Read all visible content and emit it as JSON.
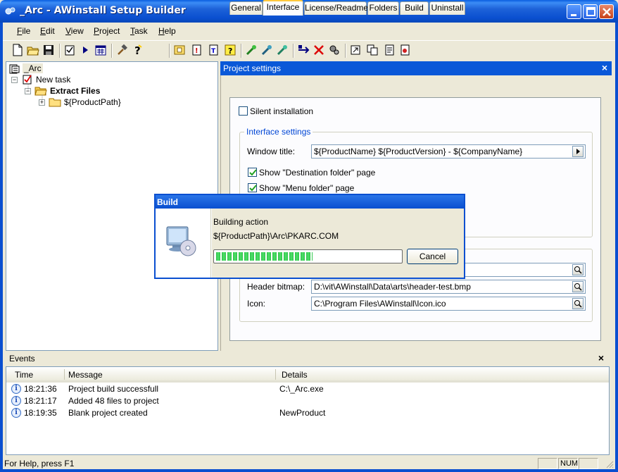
{
  "window": {
    "title": "_Arc - AWinstall Setup Builder"
  },
  "menu": [
    "File",
    "Edit",
    "View",
    "Project",
    "Task",
    "Help"
  ],
  "menu_accel": [
    "F",
    "E",
    "V",
    "P",
    "T",
    "H"
  ],
  "tree": {
    "root": "_Arc",
    "task": "New task",
    "extract": "Extract Files",
    "path": "${ProductPath}"
  },
  "project_settings": {
    "title": "Project settings",
    "tabs": [
      "General",
      "Interface",
      "License/Readme",
      "Folders",
      "Build",
      "Uninstall"
    ],
    "active_tab": "Interface",
    "silent_installation": {
      "label": "Silent installation",
      "checked": false
    },
    "interface_group": "Interface settings",
    "window_title_label": "Window title:",
    "window_title_value": "${ProductName} ${ProductVersion} - ${CompanyName}",
    "show_dest": {
      "label": "Show \"Destination folder\" page",
      "checked": true
    },
    "show_menu": {
      "label": "Show \"Menu folder\" page",
      "checked": true
    },
    "header_bitmap_label": "Header bitmap:",
    "header_bitmap_value": "D:\\vit\\AWinstall\\Data\\arts\\header-test.bmp",
    "icon_label": "Icon:",
    "icon_value": "C:\\Program Files\\AWinstall\\Icon.ico"
  },
  "build_dialog": {
    "title": "Build",
    "line1": "Building action",
    "line2": "${ProductPath}\\Arc\\PKARC.COM",
    "progress_fraction": 0.52,
    "cancel": "Cancel"
  },
  "events": {
    "title": "Events",
    "columns": [
      "Time",
      "Message",
      "Details"
    ],
    "rows": [
      {
        "time": "18:21:36",
        "message": "Project build successfull",
        "details": "C:\\_Arc.exe"
      },
      {
        "time": "18:21:17",
        "message": "Added 48 files to project",
        "details": ""
      },
      {
        "time": "18:19:35",
        "message": "Blank project created",
        "details": "NewProduct"
      }
    ]
  },
  "status": {
    "text": "For Help, press F1",
    "num": "NUM"
  },
  "colors": {
    "titlebar": "#0a4fd0",
    "progress": "#2fc34a",
    "tab_highlight": "#ffc83c"
  }
}
